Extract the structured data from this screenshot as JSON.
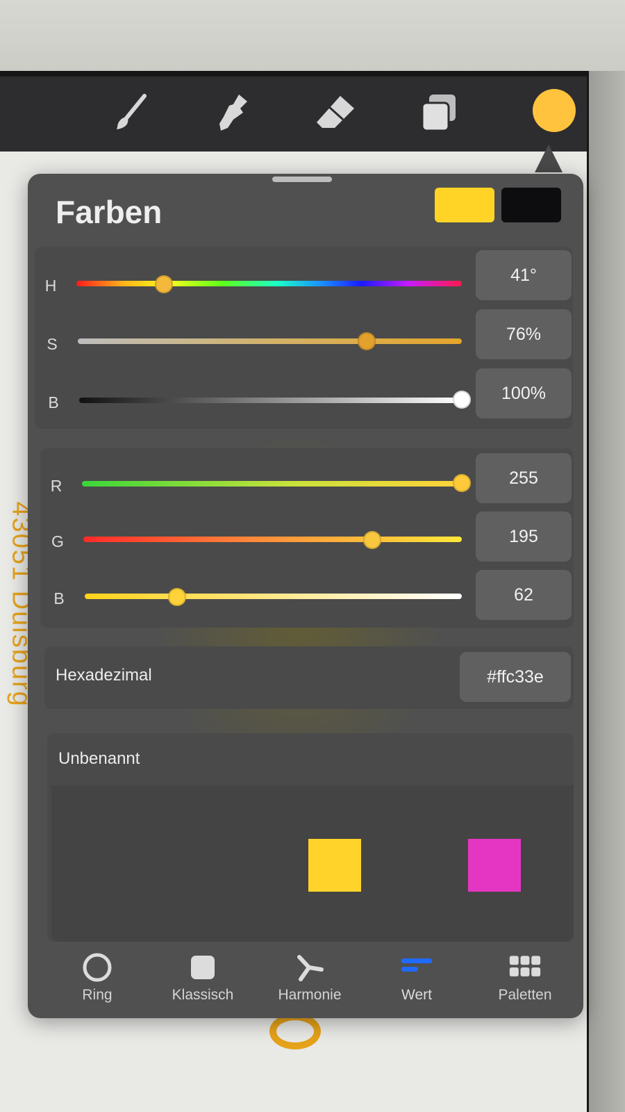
{
  "toolbar": {
    "tools": [
      {
        "icon": "brush-icon"
      },
      {
        "icon": "smudge-icon"
      },
      {
        "icon": "eraser-icon"
      },
      {
        "icon": "layers-icon"
      }
    ],
    "current_color": "#ffc33e"
  },
  "canvas": {
    "rotated_text": "43051 Duisburg"
  },
  "panel": {
    "title": "Farben",
    "primary_color": "#ffd426",
    "secondary_color": "#0d0c0f",
    "hsb": [
      {
        "label": "H",
        "value": "41°",
        "fraction": 0.22
      },
      {
        "label": "S",
        "value": "76%",
        "fraction": 0.76
      },
      {
        "label": "B",
        "value": "100%",
        "fraction": 1.0
      }
    ],
    "rgb": [
      {
        "label": "R",
        "value": "255",
        "fraction": 1.0
      },
      {
        "label": "G",
        "value": "195",
        "fraction": 0.76
      },
      {
        "label": "B",
        "value": "62",
        "fraction": 0.24
      }
    ],
    "hex": {
      "label": "Hexadezimal",
      "value": "#ffc33e"
    },
    "palette": {
      "name": "Unbenannt",
      "swatches": [
        "#ffd32a",
        "#e436c2"
      ]
    }
  },
  "tabs": [
    {
      "label": "Ring",
      "icon": "ring-icon",
      "active": false
    },
    {
      "label": "Klassisch",
      "icon": "classic-square-icon",
      "active": false
    },
    {
      "label": "Harmonie",
      "icon": "harmony-icon",
      "active": false
    },
    {
      "label": "Wert",
      "icon": "value-sliders-icon",
      "active": true
    },
    {
      "label": "Paletten",
      "icon": "palettes-grid-icon",
      "active": false
    }
  ],
  "colors": {
    "accent_blue": "#1f6bff"
  }
}
